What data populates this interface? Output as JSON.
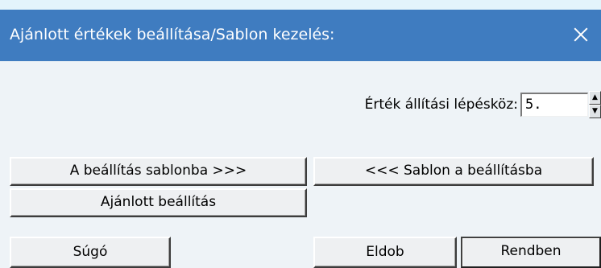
{
  "window": {
    "title": "Ajánlott értékek beállítása/Sablon kezelés:",
    "close_icon": "close-icon"
  },
  "step": {
    "label": "Érték állítási lépésköz:",
    "value": "5."
  },
  "buttons": {
    "to_template": "A beállítás sablonba >>>",
    "from_template": "<<< Sablon a beállításba",
    "recommended": "Ajánlott beállítás",
    "help": "Súgó",
    "discard": "Eldob",
    "ok": "Rendben"
  },
  "colors": {
    "titlebar": "#3f7cc0",
    "background": "#e3f4fb"
  }
}
